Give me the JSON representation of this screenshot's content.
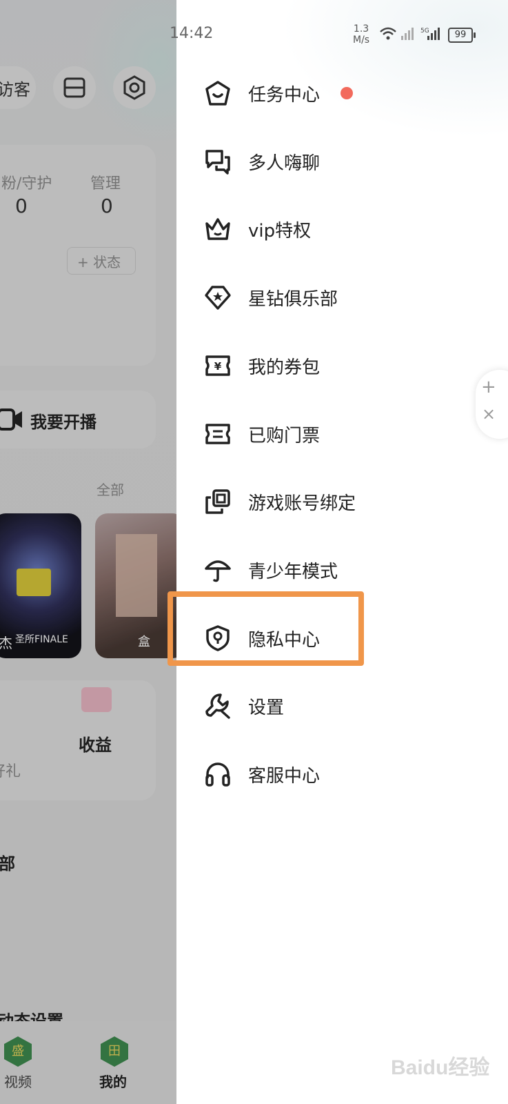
{
  "status_bar": {
    "time": "14:42",
    "net_speed_value": "1.3",
    "net_speed_unit": "M/s",
    "battery": "99"
  },
  "background_page": {
    "header_partial_label": "访客",
    "stats": [
      {
        "label": "粉/守护",
        "value": "0"
      },
      {
        "label": "管理",
        "value": "0"
      }
    ],
    "add_status_label": "+ 状态",
    "go_live_label": "我要开播",
    "view_all_label": "全部",
    "cover_captions": [
      "杰",
      "圣所FINALE",
      "盒"
    ],
    "earnings_label": "收益",
    "gift_partial_label": "好礼",
    "club_partial_label": "乐部",
    "dynamic_settings_label": "动态设置",
    "bottom_nav": [
      {
        "label": "视频",
        "glyph": "盛"
      },
      {
        "label": "我的",
        "glyph": "田"
      }
    ]
  },
  "drawer": {
    "items": [
      {
        "label": "任务中心",
        "icon": "star-house-icon",
        "has_dot": true
      },
      {
        "label": "多人嗨聊",
        "icon": "chat-bubbles-icon"
      },
      {
        "label": "vip特权",
        "icon": "crown-icon"
      },
      {
        "label": "星钻俱乐部",
        "icon": "diamond-star-icon"
      },
      {
        "label": "我的券包",
        "icon": "coupon-icon"
      },
      {
        "label": "已购门票",
        "icon": "ticket-icon"
      },
      {
        "label": "游戏账号绑定",
        "icon": "link-squares-icon"
      },
      {
        "label": "青少年模式",
        "icon": "umbrella-icon"
      },
      {
        "label": "隐私中心",
        "icon": "shield-lock-icon",
        "highlighted": true
      },
      {
        "label": "设置",
        "icon": "wrench-icon"
      },
      {
        "label": "客服中心",
        "icon": "headphones-icon"
      }
    ],
    "highlight_color": "#f0964a",
    "dot_color": "#f26a5c"
  },
  "watermark": "Baidu经验"
}
